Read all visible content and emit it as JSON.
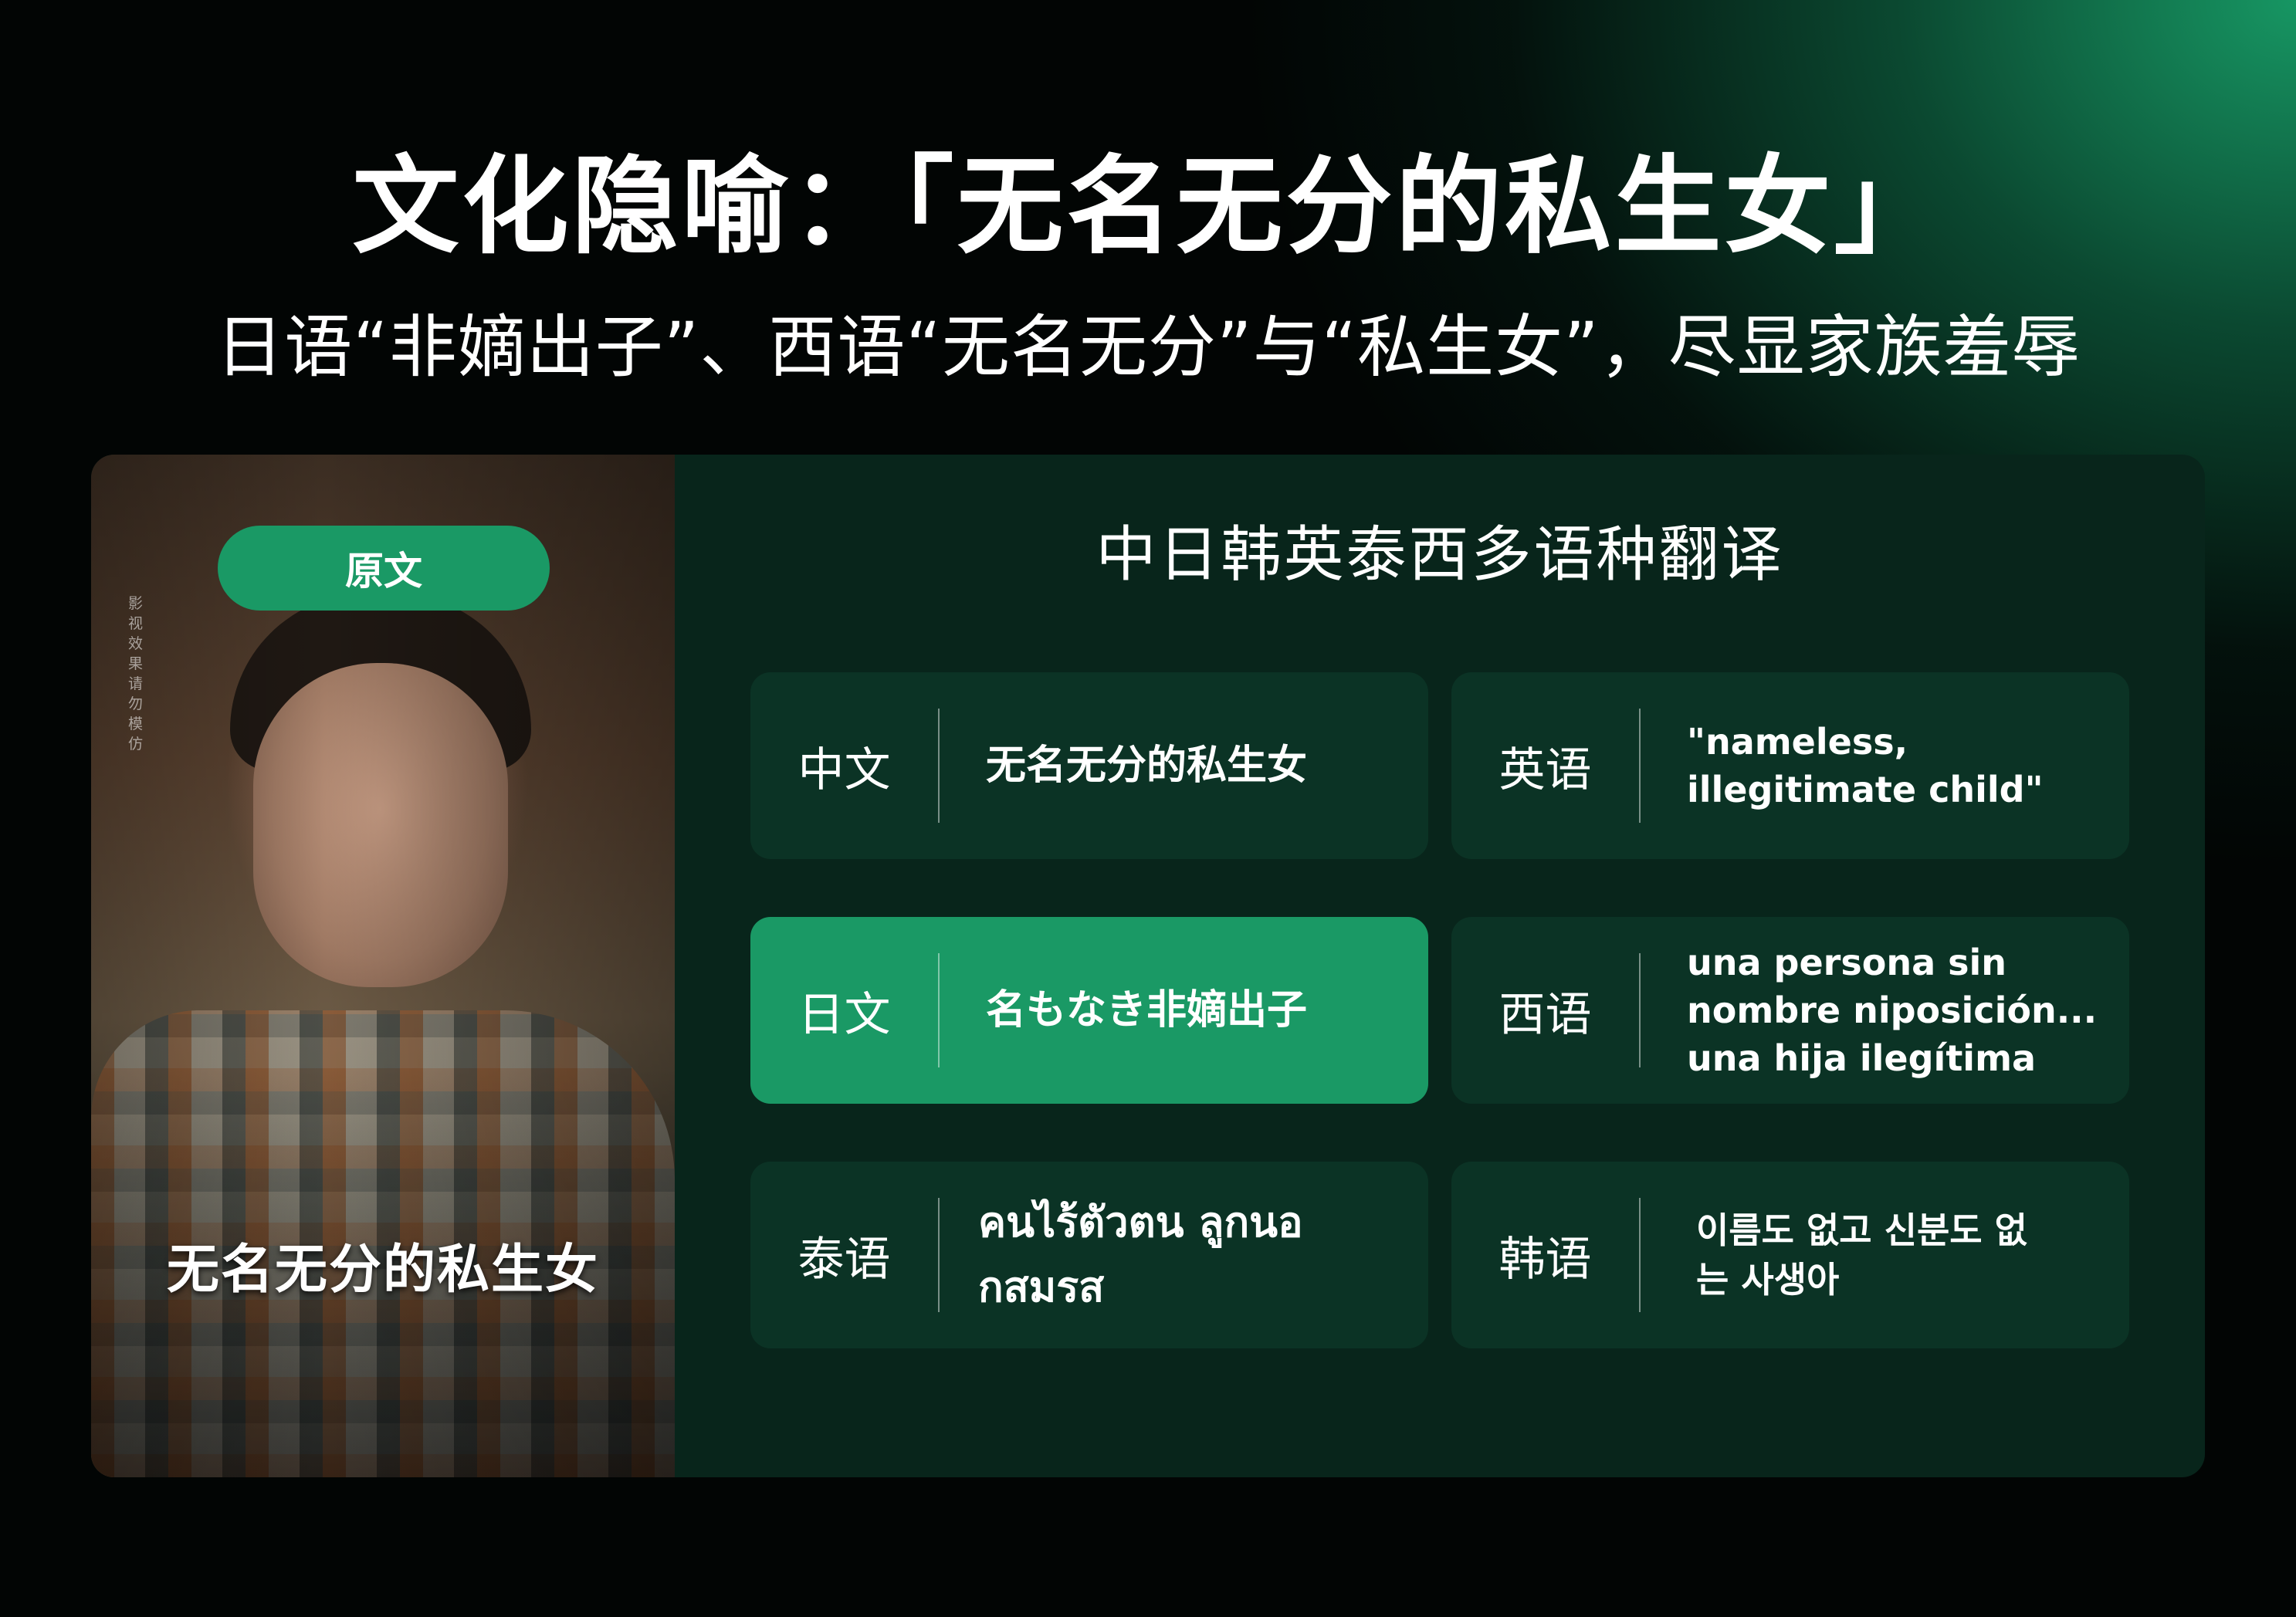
{
  "title": "文化隐喻：「无名无分的私生女」",
  "subtitle": "日语“非嫡出子”、西语“无名无分”与“私生女”，尽显家族羞辱",
  "image_panel": {
    "badge": "原文",
    "caption": "无名无分的私生女",
    "watermark": "影视效果 请勿模仿"
  },
  "translation_panel": {
    "heading": "中日韩英泰西多语种翻译",
    "cards": [
      {
        "language": "中文",
        "text": "无名无分的私生女",
        "highlighted": false
      },
      {
        "language": "英语",
        "text": "\"nameless,\nillegitimate child\"",
        "highlighted": false
      },
      {
        "language": "日文",
        "text": "名もなき非嫡出子",
        "highlighted": true
      },
      {
        "language": "西语",
        "text": "una persona sin\nnombre niposición...\nuna hija ilegítima",
        "highlighted": false
      },
      {
        "language": "泰语",
        "text": "คนไร้ตัวตน ลูกนอ\nกสมรส",
        "highlighted": false
      },
      {
        "language": "韩语",
        "text": "이름도 없고 신분도 없\n는 사생아",
        "highlighted": false
      }
    ]
  },
  "colors": {
    "accent": "#1a9965",
    "panel": "#08251b",
    "card": "#0b3325",
    "background": "#020504"
  }
}
